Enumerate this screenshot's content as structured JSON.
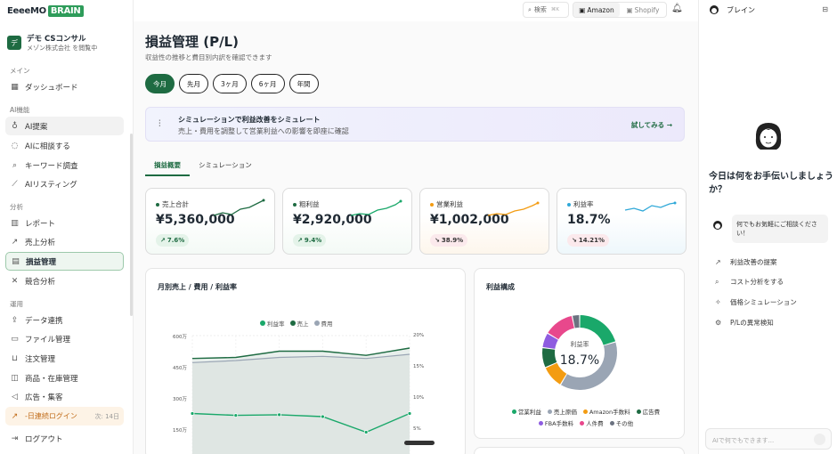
{
  "brand": {
    "part1": "EeeeMO",
    "part2": "BRAIN"
  },
  "org": {
    "initial": "デ",
    "name": "デモ CSコンサル",
    "viewing": "メゾン株式会社 を閲覧中"
  },
  "sidebar": {
    "sections": {
      "menu": "メイン",
      "ai": "AI機能",
      "analysis": "分析",
      "ops": "運用"
    },
    "items": {
      "dashboard": "ダッシュボード",
      "ai_suggest": "AI提案",
      "ai_consult": "AIに相談する",
      "keyword": "キーワード調査",
      "ai_listing": "AIリスティング",
      "report": "レポート",
      "sales": "売上分析",
      "pl": "損益管理",
      "competitor": "競合分析",
      "data_link": "データ連携",
      "files": "ファイル管理",
      "orders": "注文管理",
      "inventory": "商品・在庫管理",
      "ads": "広告・集客",
      "logout": "ログアウト"
    },
    "streak": {
      "label": "-日連続ログイン",
      "next": "次: 14日"
    }
  },
  "topbar": {
    "search_label": "検索",
    "search_key": "⌘K",
    "amazon": "Amazon",
    "shopify": "Shopify"
  },
  "page": {
    "title": "損益管理 (P/L)",
    "subtitle": "収益性の推移と費目別内訳を確認できます"
  },
  "periods": [
    "今月",
    "先月",
    "3ヶ月",
    "6ヶ月",
    "年間"
  ],
  "banner": {
    "title": "シミュレーションで利益改善をシミュレート",
    "desc": "売上・費用を調整して営業利益への影響を即座に確認",
    "cta": "試してみる →"
  },
  "tabs": [
    "損益概要",
    "シミュレーション"
  ],
  "kpis": [
    {
      "label": "売上合計",
      "value": "¥5,360,000",
      "change": "7.6%",
      "dir": "up",
      "color": "#1e6b42"
    },
    {
      "label": "粗利益",
      "value": "¥2,920,000",
      "change": "9.4%",
      "dir": "up",
      "color": "#1aa86a"
    },
    {
      "label": "営業利益",
      "value": "¥1,002,000",
      "change": "38.9%",
      "dir": "down",
      "color": "#f39c12"
    },
    {
      "label": "利益率",
      "value": "18.7%",
      "change": "14.21%",
      "dir": "down",
      "color": "#2fa8d8"
    }
  ],
  "monthly_chart": {
    "title": "月別売上 / 費用 / 利益率",
    "legend": [
      "利益率",
      "売上",
      "費用"
    ],
    "left_ticks": [
      "600万",
      "450万",
      "300万",
      "150万"
    ],
    "right_ticks": [
      "20%",
      "15%",
      "10%",
      "5%"
    ]
  },
  "profit_chart": {
    "title": "利益構成",
    "center_label": "利益率",
    "center_value": "18.7%"
  },
  "chart_data": [
    {
      "type": "line",
      "title": "月別売上 / 費用 / 利益率",
      "y_left_range": [
        0,
        600
      ],
      "y_left_unit": "万",
      "y_right_range": [
        0,
        20
      ],
      "y_right_unit": "%",
      "grid": true,
      "legend_position": "top",
      "series": [
        {
          "name": "売上",
          "type": "area",
          "axis": "left",
          "color": "#1e6b42",
          "values": [
            490,
            495,
            525,
            525,
            505,
            540
          ]
        },
        {
          "name": "費用",
          "type": "area",
          "axis": "left",
          "color": "#9aa5b4",
          "values": [
            470,
            480,
            495,
            500,
            490,
            510
          ]
        },
        {
          "name": "利益率",
          "type": "line",
          "axis": "right",
          "color": "#1aa86a",
          "values": [
            7.5,
            7.2,
            7.3,
            7.0,
            4.5,
            7.5
          ]
        }
      ]
    },
    {
      "type": "pie",
      "title": "利益構成",
      "categories": [
        "営業利益",
        "売上原価",
        "Amazon手数料",
        "広告費",
        "FBA手数料",
        "人件費",
        "その他"
      ],
      "values": [
        18.7,
        35,
        9,
        8,
        6,
        12,
        3
      ],
      "colors": [
        "#1aa86a",
        "#9aa5b4",
        "#f39c12",
        "#1e6b42",
        "#8e5ce0",
        "#e8488c",
        "#6b7280"
      ]
    }
  ],
  "assistant": {
    "name": "ブレイン",
    "greeting": "今日は何をお手伝いしましょうか？",
    "bubble": "何でもお気軽にご相談ください！",
    "suggestions": [
      "利益改善の提案",
      "コスト分析をする",
      "価格シミュレーション",
      "P/Lの異常検知"
    ],
    "input_placeholder": "AIで何でもできます..."
  }
}
